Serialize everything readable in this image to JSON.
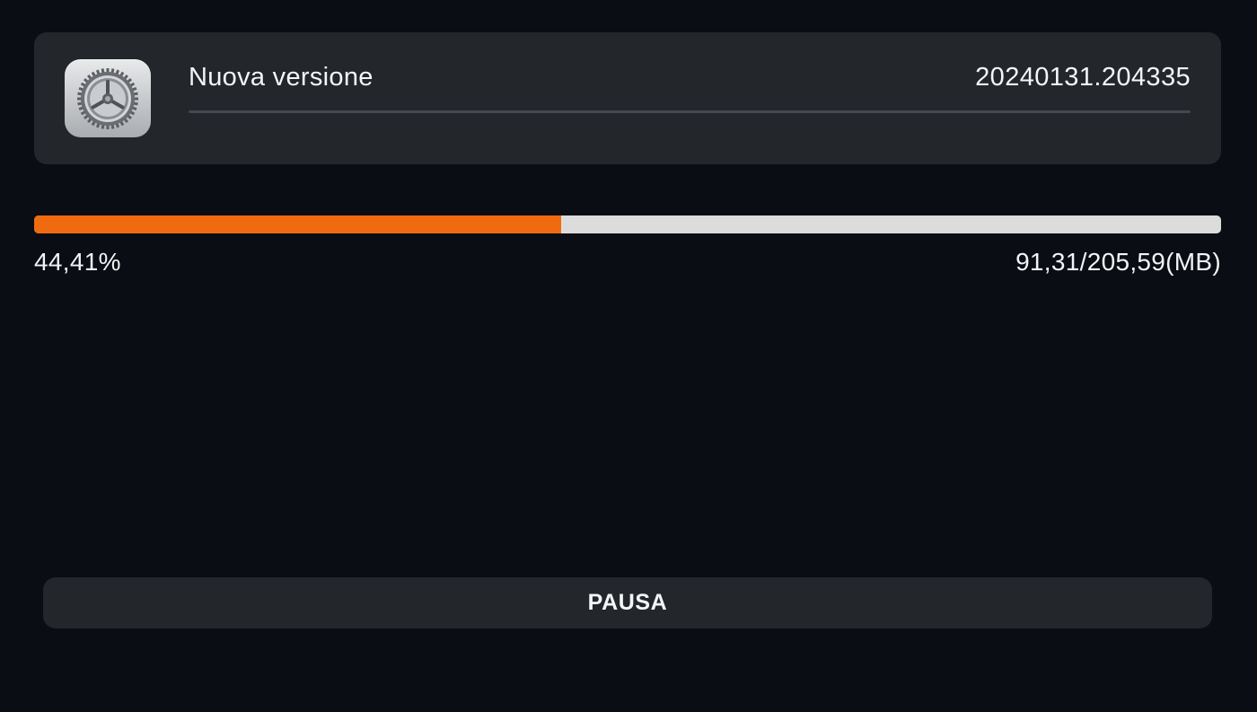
{
  "update": {
    "icon": "settings-gear-icon",
    "label": "Nuova versione",
    "version": "20240131.204335"
  },
  "progress": {
    "fraction": 0.4441,
    "percent_text": "44,41%",
    "size_text": "91,31/205,59(MB)"
  },
  "actions": {
    "pause_label": "PAUSA"
  },
  "colors": {
    "background": "#0a0d13",
    "card": "#23262b",
    "accent": "#f06a0f",
    "track": "#dcdcdc"
  }
}
